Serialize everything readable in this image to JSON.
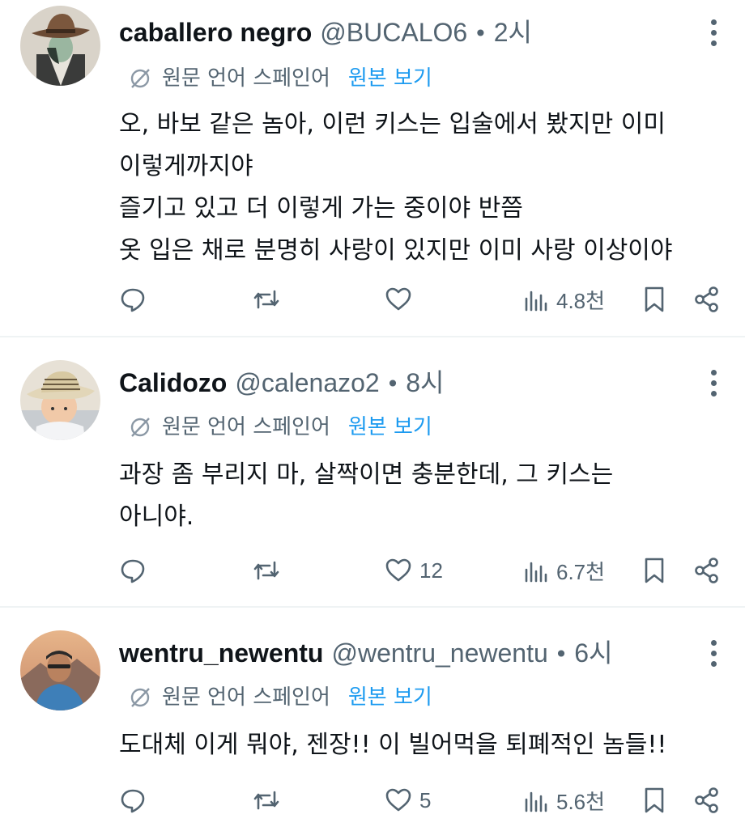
{
  "colors": {
    "text": "#0f1419",
    "secondary": "#536471",
    "link": "#1d9bf0",
    "divider": "#eff3f4"
  },
  "posts": [
    {
      "name": "caballero negro",
      "handle": "@BUCALO6",
      "sep": "•",
      "time": "2시",
      "translate_lang": "원문 언어 스페인어",
      "translate_link": "원본 보기",
      "lines": [
        "오, 바보 같은 놈아, 이런 키스는 입술에서 봤지만 이미",
        "이렇게까지야",
        "즐기고 있고 더 이렇게 가는 중이야 반쯤",
        "옷 입은 채로 분명히 사랑이 있지만 이미 사랑 이상이야"
      ],
      "likes": "",
      "views": "4.8천",
      "avatar_icon": "cowboy-hat-anime-avatar"
    },
    {
      "name": "Calidozo",
      "handle": "@calenazo2",
      "sep": "•",
      "time": "8시",
      "translate_lang": "원문 언어 스페인어",
      "translate_link": "원본 보기",
      "lines": [
        "과장 좀 부리지 마, 살짝이면 충분한데, 그 키스는",
        "아니야."
      ],
      "likes": "12",
      "views": "6.7천",
      "avatar_icon": "child-straw-hat-avatar"
    },
    {
      "name": "wentru_newentu",
      "handle": "@wentru_newentu",
      "sep": "•",
      "time": "6시",
      "translate_lang": "원문 언어 스페인어",
      "translate_link": "원본 보기",
      "lines": [
        "도대체 이게 뭐야, 젠장!! 이 빌어먹을 퇴폐적인 놈들!!"
      ],
      "likes": "5",
      "views": "5.6천",
      "avatar_icon": "hiker-photo-avatar"
    }
  ]
}
